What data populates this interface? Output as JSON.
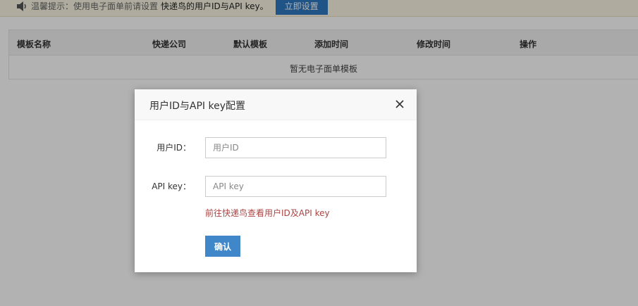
{
  "notice": {
    "icon": "speaker-icon",
    "text": "温馨提示：使用电子面单前请设置",
    "strong": "快递鸟的用户ID与API key。",
    "button": "立即设置"
  },
  "table": {
    "columns": [
      "模板名称",
      "快递公司",
      "默认模板",
      "添加时间",
      "修改时间",
      "操作"
    ],
    "empty": "暂无电子面单模板"
  },
  "modal": {
    "title": "用户ID与API key配置",
    "close_icon": "close-icon",
    "user_id_label": "用户ID：",
    "user_id_value": "",
    "user_id_placeholder": "用户ID",
    "api_key_label": "API key：",
    "api_key_value": "",
    "api_key_placeholder": "API key",
    "hint_link": "前往快递鸟查看用户ID及API key",
    "confirm": "确认"
  },
  "colors": {
    "accent": "#3f87c9",
    "link": "#a94442",
    "notice_bg": "#fbf7e4"
  }
}
